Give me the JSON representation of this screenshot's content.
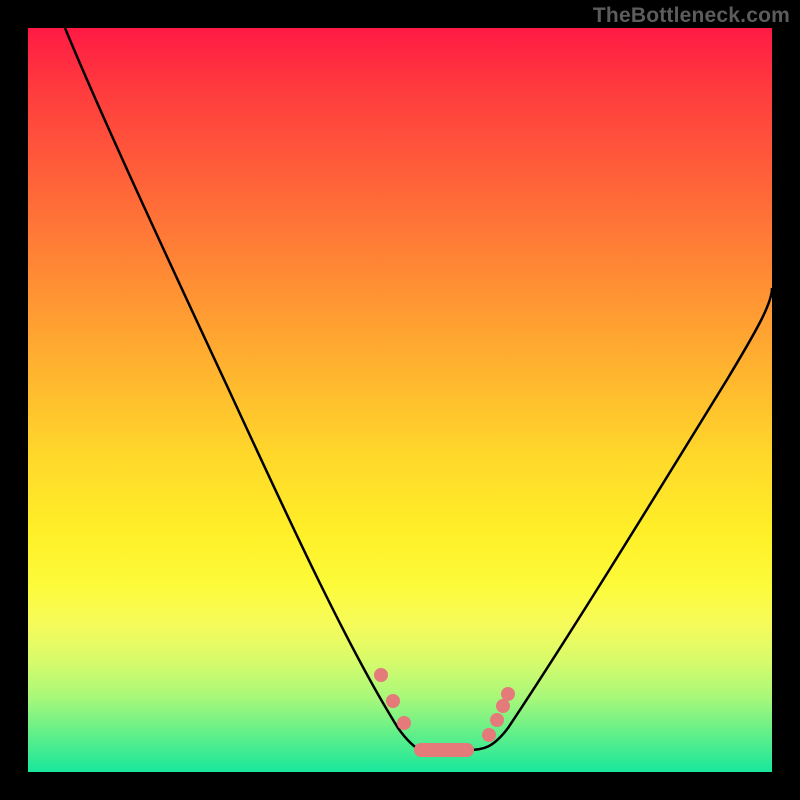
{
  "watermark": "TheBottleneck.com",
  "colors": {
    "frame": "#000000",
    "curve": "#000000",
    "marker": "#e47a7a",
    "gradient_top": "#ff1a44",
    "gradient_bottom": "#18e79c"
  },
  "chart_data": {
    "type": "line",
    "title": "",
    "xlabel": "",
    "ylabel": "",
    "xlim": [
      0,
      100
    ],
    "ylim": [
      0,
      100
    ],
    "grid": false,
    "series": [
      {
        "name": "curve",
        "x": [
          5,
          8,
          12,
          16,
          20,
          24,
          28,
          32,
          36,
          40,
          44,
          47,
          50,
          53,
          55,
          58,
          62,
          66,
          70,
          74,
          78,
          82,
          86,
          90,
          94,
          98,
          100
        ],
        "y": [
          100,
          94,
          86,
          78,
          70,
          62,
          54,
          46,
          38,
          30,
          22,
          15,
          9,
          5,
          3,
          3,
          4,
          8,
          14,
          21,
          28,
          35,
          42,
          49,
          56,
          62,
          65
        ]
      }
    ],
    "markers": [
      {
        "name": "left-dot-1",
        "x": 47.5,
        "y": 13
      },
      {
        "name": "left-dot-2",
        "x": 49.0,
        "y": 9.5
      },
      {
        "name": "left-dot-3",
        "x": 50.5,
        "y": 6.5
      },
      {
        "name": "right-dot-1",
        "x": 62.0,
        "y": 5
      },
      {
        "name": "right-dot-2",
        "x": 63.0,
        "y": 7
      },
      {
        "name": "right-dot-3",
        "x": 63.8,
        "y": 9
      },
      {
        "name": "right-dot-4",
        "x": 64.5,
        "y": 10.5
      }
    ],
    "flat_segment": {
      "x_start": 52,
      "x_end": 60,
      "y": 3
    }
  }
}
